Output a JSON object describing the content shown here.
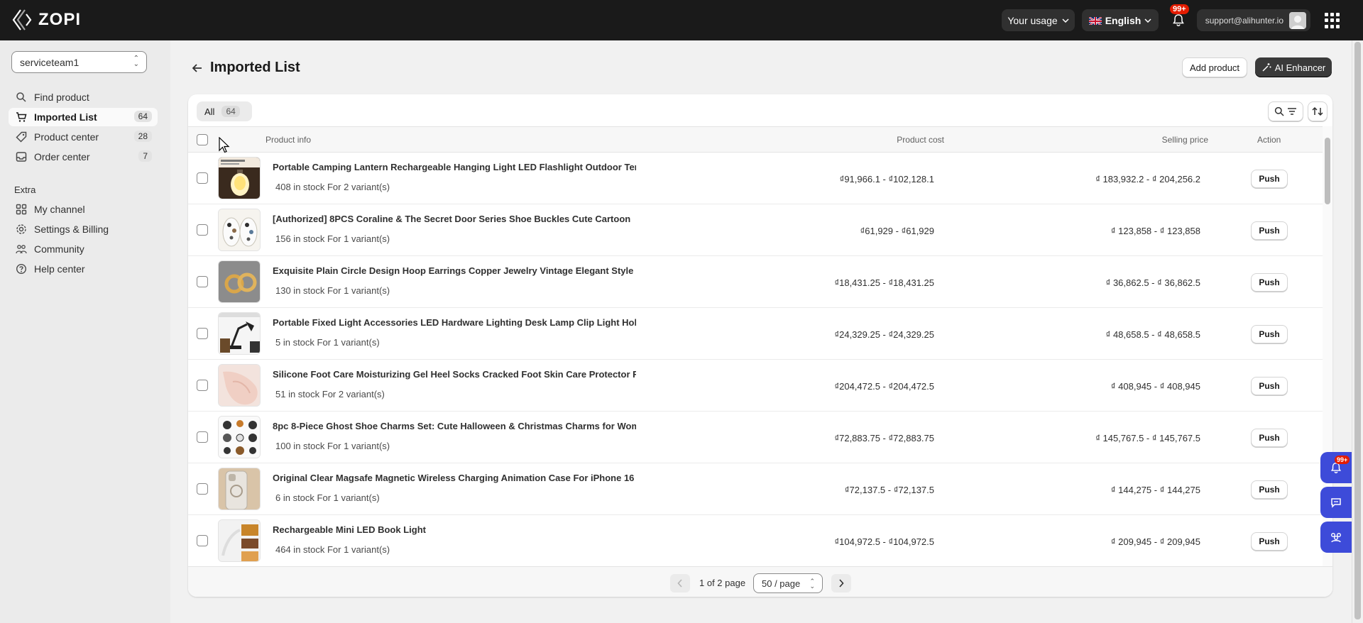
{
  "topbar": {
    "logo": "ZOPI",
    "usage_label": "Your usage",
    "language_label": "English",
    "notification_count": "99+",
    "account_email": "support@alihunter.io"
  },
  "sidebar": {
    "store": "serviceteam1",
    "items": [
      {
        "label": "Find product",
        "count": "",
        "icon": "search-icon"
      },
      {
        "label": "Imported List",
        "count": "64",
        "icon": "cart-icon"
      },
      {
        "label": "Product center",
        "count": "28",
        "icon": "tag-icon"
      },
      {
        "label": "Order center",
        "count": "7",
        "icon": "inbox-icon"
      }
    ],
    "extra_title": "Extra",
    "extra_items": [
      {
        "label": "My channel",
        "icon": "channel-icon"
      },
      {
        "label": "Settings & Billing",
        "icon": "gear-icon"
      },
      {
        "label": "Community",
        "icon": "community-icon"
      },
      {
        "label": "Help center",
        "icon": "help-icon"
      }
    ]
  },
  "main": {
    "title": "Imported List",
    "add_product_label": "Add product",
    "ai_enhancer_label": "AI Enhancer",
    "tab_all_label": "All",
    "tab_all_count": "64",
    "columns": {
      "product_info": "Product info",
      "product_cost": "Product cost",
      "selling_price": "Selling price",
      "action": "Action"
    },
    "push_label": "Push",
    "products": [
      {
        "name": "Portable Camping Lantern Rechargeable Hanging Light LED Flashlight Outdoor Tent Light",
        "stock": "408 in stock For 2 variant(s)",
        "cost": "₫91,966.1 - ₫102,128.1",
        "price": "₫ 183,932.2 - ₫ 204,256.2"
      },
      {
        "name": "[Authorized] 8PCS Coraline & The Secret Door Series Shoe Buckles Cute Cartoon",
        "stock": "156 in stock For 1 variant(s)",
        "cost": "₫61,929 - ₫61,929",
        "price": "₫ 123,858 - ₫ 123,858"
      },
      {
        "name": "Exquisite Plain Circle Design Hoop Earrings Copper Jewelry Vintage Elegant Style",
        "stock": "130 in stock For 1 variant(s)",
        "cost": "₫18,431.25 - ₫18,431.25",
        "price": "₫ 36,862.5 - ₫ 36,862.5"
      },
      {
        "name": "Portable Fixed Light Accessories LED Hardware Lighting Desk Lamp Clip Light Holder",
        "stock": "5 in stock For 1 variant(s)",
        "cost": "₫24,329.25 - ₫24,329.25",
        "price": "₫ 48,658.5 - ₫ 48,658.5"
      },
      {
        "name": "Silicone Foot Care Moisturizing Gel Heel Socks Cracked Foot Skin Care Protector Feet",
        "stock": "51 in stock For 2 variant(s)",
        "cost": "₫204,472.5 - ₫204,472.5",
        "price": "₫ 408,945 - ₫ 408,945"
      },
      {
        "name": "8pc 8-Piece Ghost Shoe Charms Set: Cute Halloween & Christmas Charms for Women",
        "stock": "100 in stock For 1 variant(s)",
        "cost": "₫72,883.75 - ₫72,883.75",
        "price": "₫ 145,767.5 - ₫ 145,767.5"
      },
      {
        "name": "Original Clear Magsafe Magnetic Wireless Charging Animation Case For iPhone 16",
        "stock": "6 in stock For 1 variant(s)",
        "cost": "₫72,137.5 - ₫72,137.5",
        "price": "₫ 144,275 - ₫ 144,275"
      },
      {
        "name": "Rechargeable Mini LED Book Light",
        "stock": "464 in stock For 1 variant(s)",
        "cost": "₫104,972.5 - ₫104,972.5",
        "price": "₫ 209,945 - ₫ 209,945"
      }
    ],
    "pagination": {
      "text": "1 of 2 page",
      "page_size": "50 / page"
    }
  },
  "floating": {
    "badge": "99+"
  }
}
